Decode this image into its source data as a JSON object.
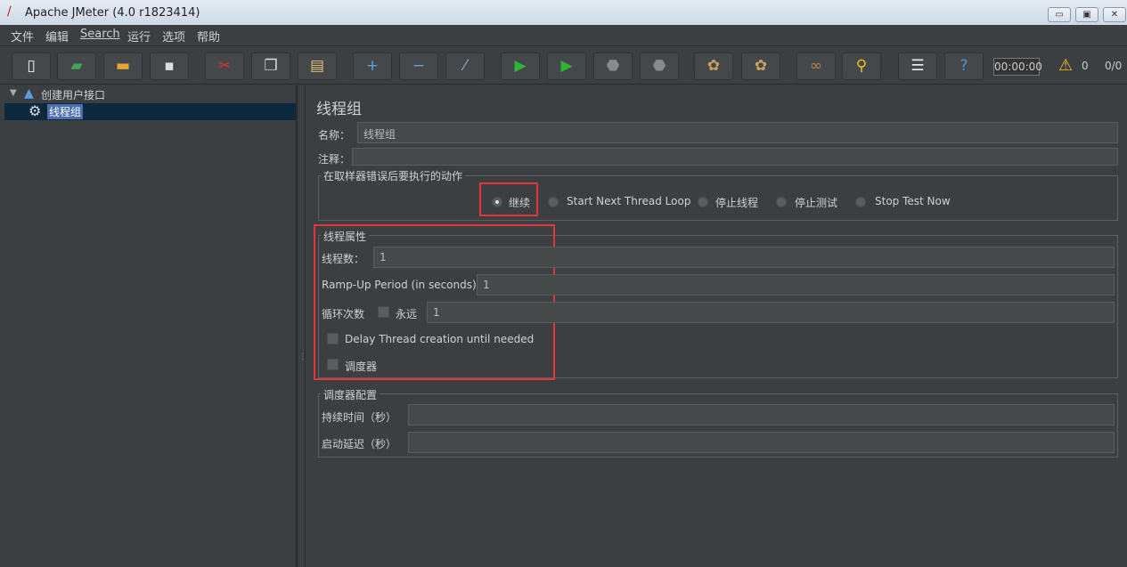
{
  "window": {
    "title": "Apache JMeter (4.0 r1823414)",
    "minimize": "▭",
    "maximize": "▣",
    "close": "✕"
  },
  "menu": [
    "文件",
    "编辑",
    "Search",
    "运行",
    "选项",
    "帮助"
  ],
  "toolbar": [
    {
      "icon": "new-icon",
      "glyph": "▯",
      "color": "#f2f2e8"
    },
    {
      "icon": "templates-icon",
      "glyph": "▰",
      "color": "#3ea55a"
    },
    {
      "icon": "open-icon",
      "glyph": "▬",
      "color": "#e8a82e"
    },
    {
      "icon": "save-icon",
      "glyph": "▪",
      "color": "#dddddd"
    },
    {
      "icon": "cut-icon",
      "glyph": "✂",
      "color": "#e03030"
    },
    {
      "icon": "copy-icon",
      "glyph": "❐",
      "color": "#dddddd"
    },
    {
      "icon": "paste-icon",
      "glyph": "▤",
      "color": "#e6c070"
    },
    {
      "icon": "expand-icon",
      "glyph": "+",
      "color": "#5aa0e6"
    },
    {
      "icon": "collapse-icon",
      "glyph": "−",
      "color": "#5aa0e6"
    },
    {
      "icon": "toggle-icon",
      "glyph": "⁄",
      "color": "#80b0e0"
    },
    {
      "icon": "start-icon",
      "glyph": "▶",
      "color": "#2fb52f"
    },
    {
      "icon": "start-no-pauses-icon",
      "glyph": "▶",
      "color": "#2fb52f"
    },
    {
      "icon": "stop-icon",
      "glyph": "⬣",
      "color": "#8a8a8a"
    },
    {
      "icon": "shutdown-icon",
      "glyph": "⬣",
      "color": "#8a8a8a"
    },
    {
      "icon": "clear-icon",
      "glyph": "✿",
      "color": "#c9a060"
    },
    {
      "icon": "clear-all-icon",
      "glyph": "✿",
      "color": "#c9a060"
    },
    {
      "icon": "search-icon",
      "glyph": "∞",
      "color": "#c08040"
    },
    {
      "icon": "reset-search-icon",
      "glyph": "⚲",
      "color": "#f0c020"
    },
    {
      "icon": "function-helper-icon",
      "glyph": "☰",
      "color": "#eeeeee"
    },
    {
      "icon": "help-icon",
      "glyph": "?",
      "color": "#4a90e0"
    }
  ],
  "status": {
    "timer": "00:00:00",
    "warnings": "0",
    "threads": "0/0"
  },
  "tree": {
    "root": "创建用户接口",
    "child": "线程组"
  },
  "panel": {
    "title": "线程组",
    "name_label": "名称：",
    "name_value": "线程组",
    "comment_label": "注释：",
    "comment_value": "",
    "error_action": {
      "title": "在取样器错误后要执行的动作",
      "options": [
        "继续",
        "Start Next Thread Loop",
        "停止线程",
        "停止测试",
        "Stop Test Now"
      ],
      "selected": "继续"
    },
    "thread_props": {
      "title": "线程属性",
      "threads_label": "线程数：",
      "threads_value": "1",
      "rampup_label": "Ramp-Up Period (in seconds):",
      "rampup_value": "1",
      "loop_label": "循环次数",
      "forever_label": "永远",
      "loop_value": "1",
      "delay_label": "Delay Thread creation until needed",
      "scheduler_label": "调度器"
    },
    "scheduler": {
      "title": "调度器配置",
      "duration_label": "持续时间（秒）",
      "duration_value": "",
      "delay_label": "启动延迟（秒）",
      "delay_value": ""
    }
  }
}
